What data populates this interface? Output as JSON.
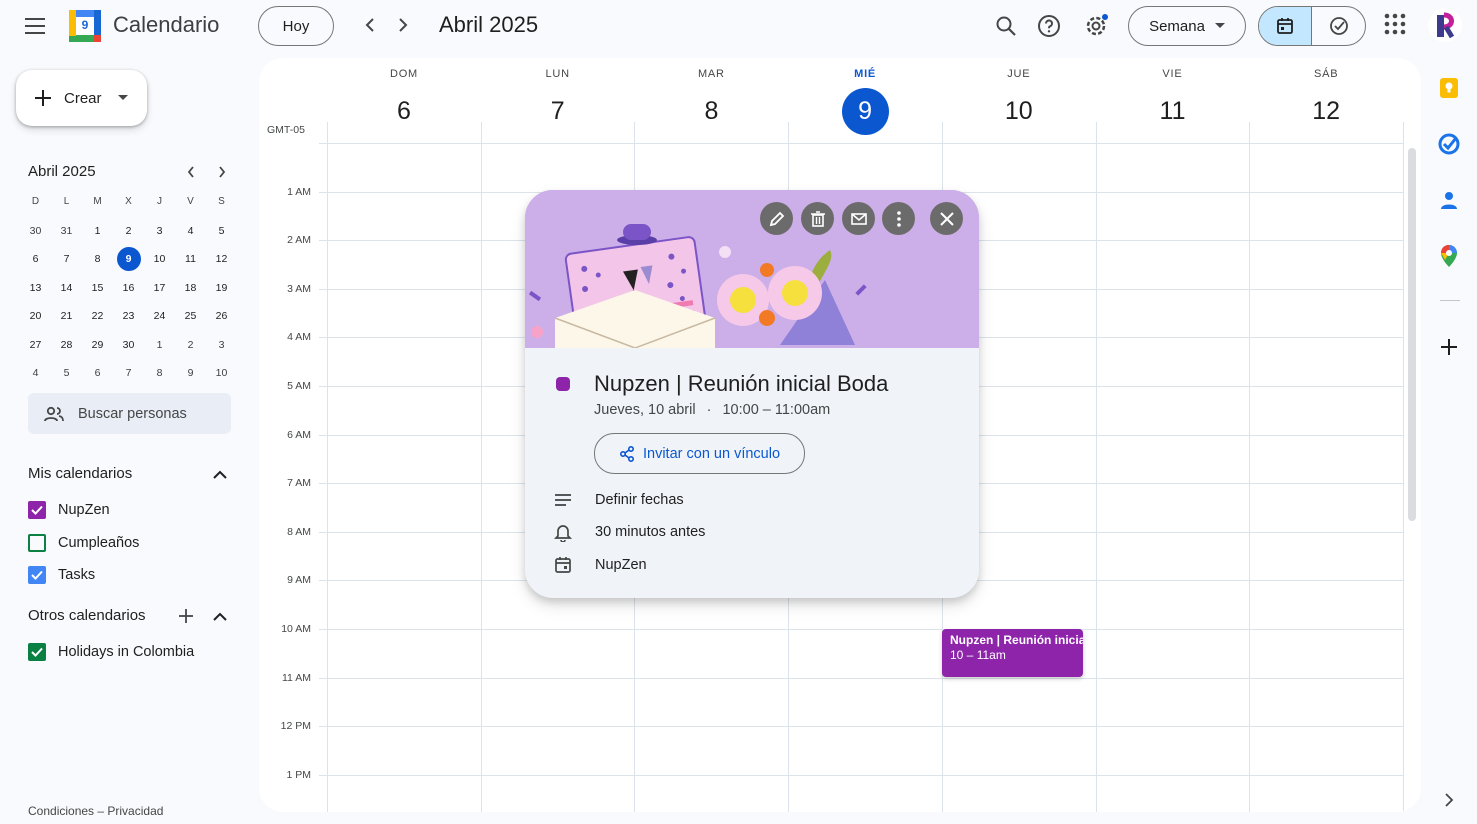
{
  "app": {
    "title": "Calendario",
    "logo_day": "9"
  },
  "toolbar": {
    "today_label": "Hoy",
    "period_title": "Abril 2025",
    "view_label": "Semana"
  },
  "sidebar": {
    "create_label": "Crear",
    "mini_month_title": "Abril 2025",
    "weekday_initials": [
      "D",
      "L",
      "M",
      "X",
      "J",
      "V",
      "S"
    ],
    "weeks": [
      [
        "30",
        "31",
        "1",
        "2",
        "3",
        "4",
        "5"
      ],
      [
        "6",
        "7",
        "8",
        "9",
        "10",
        "11",
        "12"
      ],
      [
        "13",
        "14",
        "15",
        "16",
        "17",
        "18",
        "19"
      ],
      [
        "20",
        "21",
        "22",
        "23",
        "24",
        "25",
        "26"
      ],
      [
        "27",
        "28",
        "29",
        "30",
        "1",
        "2",
        "3"
      ],
      [
        "4",
        "5",
        "6",
        "7",
        "8",
        "9",
        "10"
      ]
    ],
    "search_people_placeholder": "Buscar personas",
    "my_calendars_title": "Mis calendarios",
    "my_calendars": [
      {
        "name": "NupZen",
        "checked": true,
        "color": "#8e24aa"
      },
      {
        "name": "Cumpleaños",
        "checked": false,
        "color": "#0b8043"
      },
      {
        "name": "Tasks",
        "checked": true,
        "color": "#4285f4"
      }
    ],
    "other_calendars_title": "Otros calendarios",
    "other_calendars": [
      {
        "name": "Holidays in Colombia",
        "checked": true,
        "color": "#0b8043"
      }
    ],
    "footer": "Condiciones – Privacidad"
  },
  "week": {
    "timezone": "GMT-05",
    "days": [
      {
        "name": "DOM",
        "num": "6"
      },
      {
        "name": "LUN",
        "num": "7"
      },
      {
        "name": "MAR",
        "num": "8"
      },
      {
        "name": "MIÉ",
        "num": "9",
        "today": true
      },
      {
        "name": "JUE",
        "num": "10"
      },
      {
        "name": "VIE",
        "num": "11"
      },
      {
        "name": "SÁB",
        "num": "12"
      }
    ],
    "hours": [
      "1 AM",
      "2 AM",
      "3 AM",
      "4 AM",
      "5 AM",
      "6 AM",
      "7 AM",
      "8 AM",
      "9 AM",
      "10 AM",
      "11 AM",
      "12 PM",
      "1 PM"
    ]
  },
  "event": {
    "chip_title": "Nupzen | Reunión inicial Boda",
    "chip_time": "10 – 11am",
    "color": "#8e24aa"
  },
  "popup": {
    "title": "Nupzen | Reunión inicial Boda",
    "date": "Jueves, 10 abril",
    "time": "10:00 – 11:00am",
    "invite_label": "Invitar con un vínculo",
    "description": "Definir fechas",
    "reminder": "30 minutos antes",
    "calendar": "NupZen"
  }
}
